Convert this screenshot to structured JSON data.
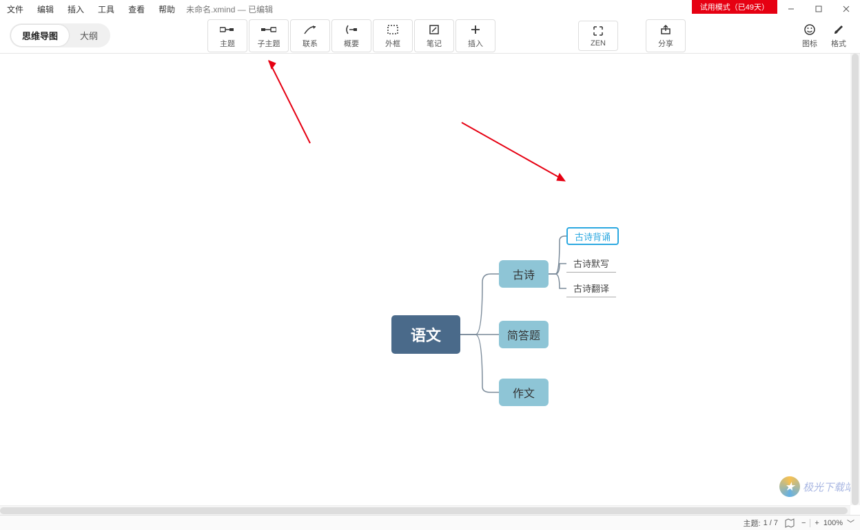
{
  "menu": {
    "items": [
      "文件",
      "编辑",
      "插入",
      "工具",
      "查看",
      "帮助"
    ],
    "doc_title": "未命名.xmind — 已编辑",
    "trial_badge": "试用模式（已49天）"
  },
  "view_tabs": {
    "mindmap": "思维导图",
    "outline": "大纲"
  },
  "toolbar": {
    "topic": "主题",
    "subtopic": "子主题",
    "relation": "联系",
    "summary": "概要",
    "boundary": "外框",
    "note": "笔记",
    "insert": "插入",
    "zen": "ZEN",
    "share": "分享",
    "icons": "图标",
    "format": "格式"
  },
  "mindmap": {
    "central": "语文",
    "branches": [
      {
        "label": "古诗",
        "children": [
          "古诗背诵",
          "古诗默写",
          "古诗翻译"
        ],
        "selected_child_index": 0
      },
      {
        "label": "简答题",
        "children": []
      },
      {
        "label": "作文",
        "children": []
      }
    ]
  },
  "statusbar": {
    "topic_counter_label": "主题:",
    "topic_counter_value": "1 / 7",
    "zoom": "100%"
  },
  "watermark": "极光下载站"
}
